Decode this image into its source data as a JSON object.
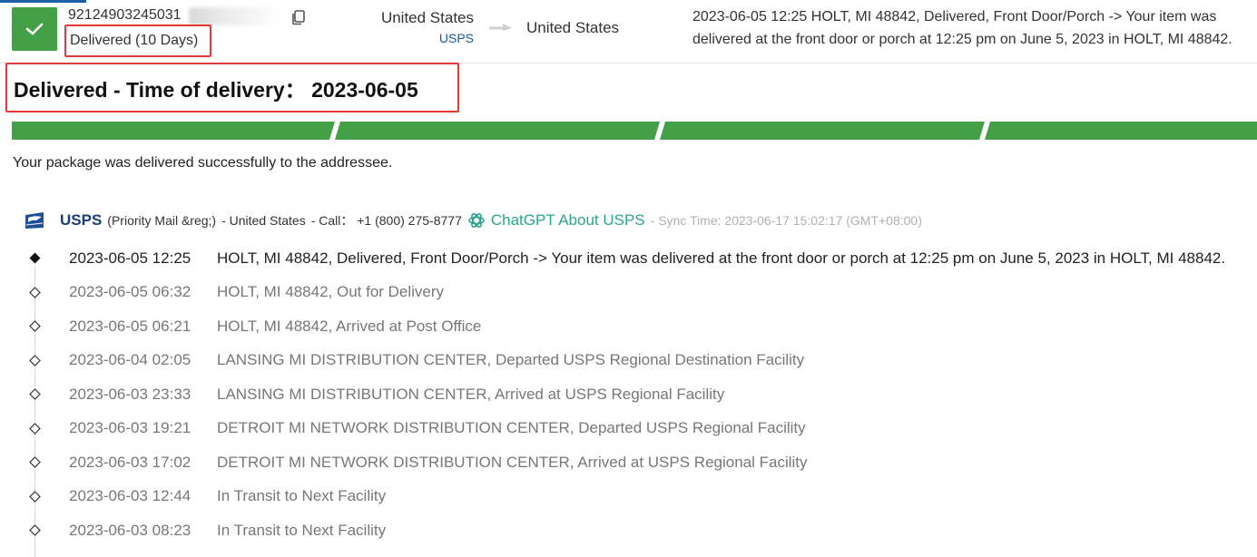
{
  "shipment": {
    "tracking_number": "92124903245031",
    "status_label": "Delivered (10 Days)",
    "origin_country": "United States",
    "origin_carrier": "USPS",
    "destination_country": "United States",
    "latest_event": "2023-06-05 12:25  HOLT, MI 48842, Delivered, Front Door/Porch -> Your item was delivered at the front door or porch at 12:25 pm on June 5, 2023 in HOLT, MI 48842."
  },
  "headline": "Delivered - Time of delivery： 2023-06-05",
  "progress": {
    "segments_total": 4,
    "segments_complete": 4,
    "color": "#43a047"
  },
  "status_message": "Your package was delivered successfully to the addressee.",
  "carrier": {
    "name": "USPS",
    "service": "(Priority Mail &reg;)",
    "country": "- United States",
    "call": "- Call： +1 (800) 275-8777",
    "chatgpt_label": "ChatGPT About USPS",
    "sync_time": "- Sync Time: 2023-06-17 15:02:17 (GMT+08:00)"
  },
  "events": [
    {
      "time": "2023-06-05 12:25",
      "desc": "HOLT, MI 48842, Delivered, Front Door/Porch -> Your item was delivered at the front door or porch at 12:25 pm on June 5, 2023 in HOLT, MI 48842."
    },
    {
      "time": "2023-06-05 06:32",
      "desc": "HOLT, MI 48842, Out for Delivery"
    },
    {
      "time": "2023-06-05 06:21",
      "desc": "HOLT, MI 48842, Arrived at Post Office"
    },
    {
      "time": "2023-06-04 02:05",
      "desc": "LANSING MI DISTRIBUTION CENTER, Departed USPS Regional Destination Facility"
    },
    {
      "time": "2023-06-03 23:33",
      "desc": "LANSING MI DISTRIBUTION CENTER, Arrived at USPS Regional Facility"
    },
    {
      "time": "2023-06-03 19:21",
      "desc": "DETROIT MI NETWORK DISTRIBUTION CENTER, Departed USPS Regional Facility"
    },
    {
      "time": "2023-06-03 17:02",
      "desc": "DETROIT MI NETWORK DISTRIBUTION CENTER, Arrived at USPS Regional Facility"
    },
    {
      "time": "2023-06-03 12:44",
      "desc": "In Transit to Next Facility"
    },
    {
      "time": "2023-06-03 08:23",
      "desc": "In Transit to Next Facility"
    }
  ],
  "icons": {
    "status": "checkmark-icon",
    "copy": "copy-icon",
    "route": "arrow-right-icon",
    "carrier_logo": "usps-eagle-logo",
    "chatgpt": "openai-icon",
    "current_event": "filled-diamond-icon",
    "past_event": "hollow-diamond-icon"
  }
}
